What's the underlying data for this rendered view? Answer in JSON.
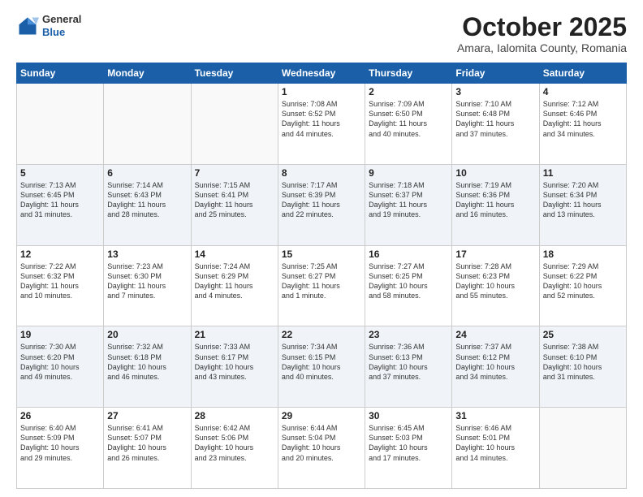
{
  "header": {
    "logo_line1": "General",
    "logo_line2": "Blue",
    "month": "October 2025",
    "location": "Amara, Ialomita County, Romania"
  },
  "weekdays": [
    "Sunday",
    "Monday",
    "Tuesday",
    "Wednesday",
    "Thursday",
    "Friday",
    "Saturday"
  ],
  "rows": [
    [
      {
        "day": "",
        "info": ""
      },
      {
        "day": "",
        "info": ""
      },
      {
        "day": "",
        "info": ""
      },
      {
        "day": "1",
        "info": "Sunrise: 7:08 AM\nSunset: 6:52 PM\nDaylight: 11 hours\nand 44 minutes."
      },
      {
        "day": "2",
        "info": "Sunrise: 7:09 AM\nSunset: 6:50 PM\nDaylight: 11 hours\nand 40 minutes."
      },
      {
        "day": "3",
        "info": "Sunrise: 7:10 AM\nSunset: 6:48 PM\nDaylight: 11 hours\nand 37 minutes."
      },
      {
        "day": "4",
        "info": "Sunrise: 7:12 AM\nSunset: 6:46 PM\nDaylight: 11 hours\nand 34 minutes."
      }
    ],
    [
      {
        "day": "5",
        "info": "Sunrise: 7:13 AM\nSunset: 6:45 PM\nDaylight: 11 hours\nand 31 minutes."
      },
      {
        "day": "6",
        "info": "Sunrise: 7:14 AM\nSunset: 6:43 PM\nDaylight: 11 hours\nand 28 minutes."
      },
      {
        "day": "7",
        "info": "Sunrise: 7:15 AM\nSunset: 6:41 PM\nDaylight: 11 hours\nand 25 minutes."
      },
      {
        "day": "8",
        "info": "Sunrise: 7:17 AM\nSunset: 6:39 PM\nDaylight: 11 hours\nand 22 minutes."
      },
      {
        "day": "9",
        "info": "Sunrise: 7:18 AM\nSunset: 6:37 PM\nDaylight: 11 hours\nand 19 minutes."
      },
      {
        "day": "10",
        "info": "Sunrise: 7:19 AM\nSunset: 6:36 PM\nDaylight: 11 hours\nand 16 minutes."
      },
      {
        "day": "11",
        "info": "Sunrise: 7:20 AM\nSunset: 6:34 PM\nDaylight: 11 hours\nand 13 minutes."
      }
    ],
    [
      {
        "day": "12",
        "info": "Sunrise: 7:22 AM\nSunset: 6:32 PM\nDaylight: 11 hours\nand 10 minutes."
      },
      {
        "day": "13",
        "info": "Sunrise: 7:23 AM\nSunset: 6:30 PM\nDaylight: 11 hours\nand 7 minutes."
      },
      {
        "day": "14",
        "info": "Sunrise: 7:24 AM\nSunset: 6:29 PM\nDaylight: 11 hours\nand 4 minutes."
      },
      {
        "day": "15",
        "info": "Sunrise: 7:25 AM\nSunset: 6:27 PM\nDaylight: 11 hours\nand 1 minute."
      },
      {
        "day": "16",
        "info": "Sunrise: 7:27 AM\nSunset: 6:25 PM\nDaylight: 10 hours\nand 58 minutes."
      },
      {
        "day": "17",
        "info": "Sunrise: 7:28 AM\nSunset: 6:23 PM\nDaylight: 10 hours\nand 55 minutes."
      },
      {
        "day": "18",
        "info": "Sunrise: 7:29 AM\nSunset: 6:22 PM\nDaylight: 10 hours\nand 52 minutes."
      }
    ],
    [
      {
        "day": "19",
        "info": "Sunrise: 7:30 AM\nSunset: 6:20 PM\nDaylight: 10 hours\nand 49 minutes."
      },
      {
        "day": "20",
        "info": "Sunrise: 7:32 AM\nSunset: 6:18 PM\nDaylight: 10 hours\nand 46 minutes."
      },
      {
        "day": "21",
        "info": "Sunrise: 7:33 AM\nSunset: 6:17 PM\nDaylight: 10 hours\nand 43 minutes."
      },
      {
        "day": "22",
        "info": "Sunrise: 7:34 AM\nSunset: 6:15 PM\nDaylight: 10 hours\nand 40 minutes."
      },
      {
        "day": "23",
        "info": "Sunrise: 7:36 AM\nSunset: 6:13 PM\nDaylight: 10 hours\nand 37 minutes."
      },
      {
        "day": "24",
        "info": "Sunrise: 7:37 AM\nSunset: 6:12 PM\nDaylight: 10 hours\nand 34 minutes."
      },
      {
        "day": "25",
        "info": "Sunrise: 7:38 AM\nSunset: 6:10 PM\nDaylight: 10 hours\nand 31 minutes."
      }
    ],
    [
      {
        "day": "26",
        "info": "Sunrise: 6:40 AM\nSunset: 5:09 PM\nDaylight: 10 hours\nand 29 minutes."
      },
      {
        "day": "27",
        "info": "Sunrise: 6:41 AM\nSunset: 5:07 PM\nDaylight: 10 hours\nand 26 minutes."
      },
      {
        "day": "28",
        "info": "Sunrise: 6:42 AM\nSunset: 5:06 PM\nDaylight: 10 hours\nand 23 minutes."
      },
      {
        "day": "29",
        "info": "Sunrise: 6:44 AM\nSunset: 5:04 PM\nDaylight: 10 hours\nand 20 minutes."
      },
      {
        "day": "30",
        "info": "Sunrise: 6:45 AM\nSunset: 5:03 PM\nDaylight: 10 hours\nand 17 minutes."
      },
      {
        "day": "31",
        "info": "Sunrise: 6:46 AM\nSunset: 5:01 PM\nDaylight: 10 hours\nand 14 minutes."
      },
      {
        "day": "",
        "info": ""
      }
    ]
  ]
}
